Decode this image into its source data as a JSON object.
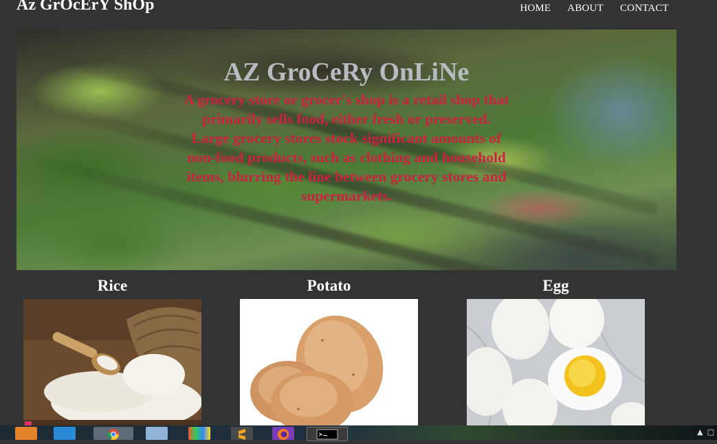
{
  "brand": "Az GrOcErY ShOp",
  "nav": {
    "home": "HOME",
    "about": "ABOUT",
    "contact": "CONTACT"
  },
  "hero": {
    "title": "AZ GroCeRy OnLiNe",
    "text": "A grocery store or grocer's shop is a retail shop that primarily sells food, either fresh or preserved. Large grocery stores stock significant amounts of non-food products, such as clothing and household items, blurring the line between grocery stores and supermarkets."
  },
  "products": [
    {
      "name": "Rice"
    },
    {
      "name": "Potato"
    },
    {
      "name": "Egg"
    }
  ],
  "colors": {
    "background": "#333333",
    "hero_title": "#b7bcc1",
    "hero_text": "#c5243f"
  },
  "taskbar": {
    "icons": [
      "media-player-icon",
      "vscode-icon",
      "chrome-icon",
      "notepad-icon",
      "color-app-icon",
      "sublime-icon",
      "firefox-icon",
      "cmd-icon"
    ]
  }
}
